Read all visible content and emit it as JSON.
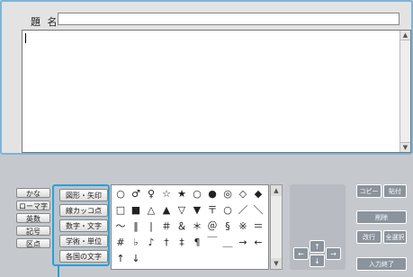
{
  "editor": {
    "title_label": "題 名",
    "title_value": "",
    "body_value": ""
  },
  "modes": [
    "かな",
    "ローマ字",
    "英数",
    "記号",
    "区点"
  ],
  "categories": [
    "図形・矢印",
    "線カッコ点",
    "数字・文字",
    "学術・単位",
    "各国の文字"
  ],
  "symbols": [
    [
      "○",
      "♂",
      "♀",
      "☆",
      "★",
      "○",
      "●",
      "◎",
      "◇",
      "◆"
    ],
    [
      "□",
      "■",
      "△",
      "▲",
      "▽",
      "▼",
      "〒",
      "○",
      "／",
      "＼"
    ],
    [
      "～",
      "‖",
      "|",
      "＃",
      "＆",
      "＊",
      "＠",
      "§",
      "※",
      "＝"
    ],
    [
      "#",
      "♭",
      "♪",
      "†",
      "‡",
      "¶",
      "￣",
      "＿",
      "→",
      "←"
    ],
    [
      "↑",
      "↓",
      "",
      "",
      "",
      "",
      "",
      "",
      "",
      ""
    ]
  ],
  "arrows": {
    "up": "↑",
    "down": "↓",
    "left": "←",
    "right": "→"
  },
  "actions": {
    "copy": "コピー",
    "paste": "貼付",
    "delete": "削除",
    "newline": "改行",
    "select_all": "全選択",
    "finish": "入力終了"
  },
  "icons": {
    "scroll_up": "▲",
    "scroll_down": "▼"
  }
}
